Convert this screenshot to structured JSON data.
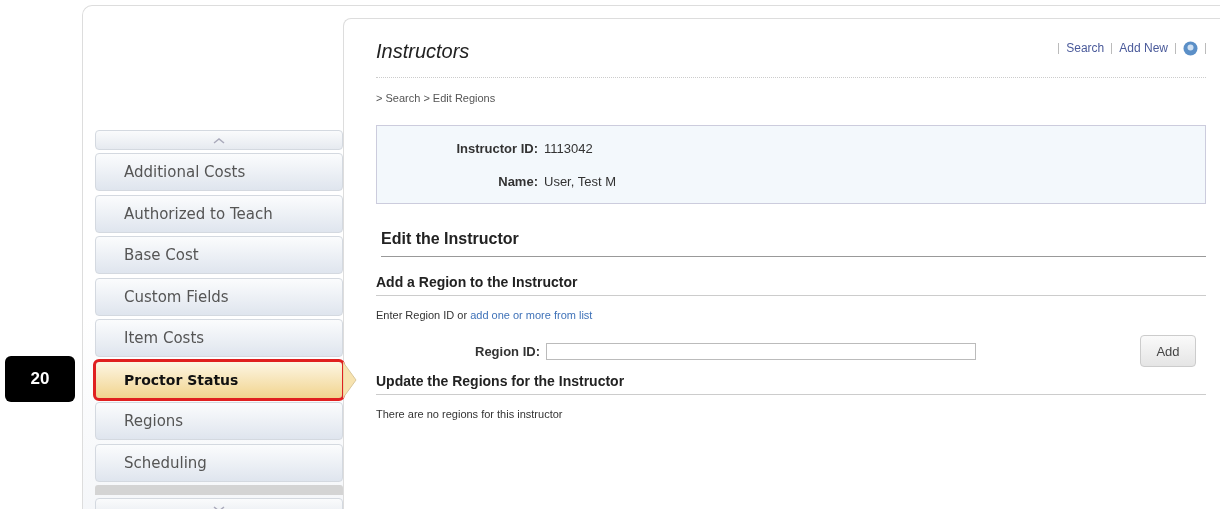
{
  "callout": {
    "number": "20"
  },
  "sidebar": {
    "items": [
      {
        "label": "Additional Costs",
        "selected": false
      },
      {
        "label": "Authorized to Teach",
        "selected": false
      },
      {
        "label": "Base Cost",
        "selected": false
      },
      {
        "label": "Custom Fields",
        "selected": false
      },
      {
        "label": "Item Costs",
        "selected": false
      },
      {
        "label": "Proctor Status",
        "selected": true
      },
      {
        "label": "Regions",
        "selected": false
      },
      {
        "label": "Scheduling",
        "selected": false
      }
    ]
  },
  "header": {
    "title": "Instructors",
    "links": [
      "Search",
      "Add New"
    ]
  },
  "breadcrumb": "> Search > Edit Regions",
  "info": [
    {
      "label": "Instructor ID:",
      "value": "1113042"
    },
    {
      "label": "Name:",
      "value": "User, Test M"
    }
  ],
  "edit_heading": "Edit the Instructor",
  "add_section": {
    "heading": "Add a Region to the Instructor",
    "hint": "Enter Region ID or",
    "hint_link": "add one or more from list",
    "field_label": "Region ID:",
    "button": "Add"
  },
  "update_section": {
    "heading": "Update the Regions for the Instructor",
    "message": "There are no regions for this instructor"
  }
}
